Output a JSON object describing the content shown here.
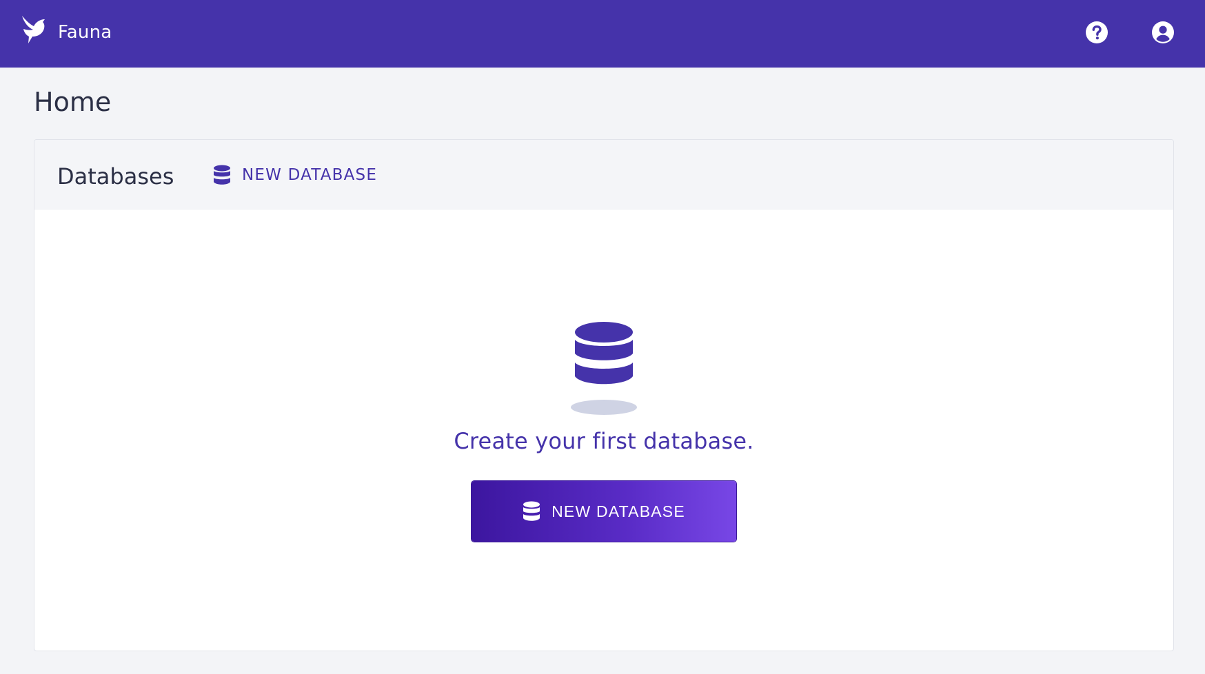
{
  "app": {
    "name": "Fauna",
    "logo_icon": "fauna-bird-logo-icon"
  },
  "topbar": {
    "help_icon": "question-circle-icon",
    "account_icon": "user-circle-icon"
  },
  "page": {
    "title": "Home"
  },
  "databases_panel": {
    "title": "Databases",
    "header_action": {
      "icon": "database-icon",
      "label": "NEW DATABASE"
    },
    "empty_state": {
      "icon": "database-stack-icon",
      "message": "Create your first database.",
      "button": {
        "icon": "database-icon",
        "label": "NEW DATABASE"
      }
    }
  },
  "colors": {
    "brand_purple": "#4533aa",
    "page_background": "#f3f4f7",
    "panel_header_background": "#f4f5f8",
    "cta_gradient_start": "#3c169f",
    "cta_gradient_end": "#7847e6",
    "shadow_ellipse": "#cfd3e4"
  }
}
